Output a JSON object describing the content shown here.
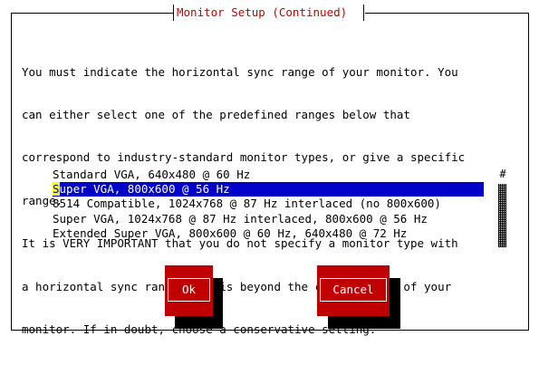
{
  "dialog": {
    "title": "Monitor Setup (Continued)",
    "body_lines": [
      "You must indicate the horizontal sync range of your monitor. You",
      "can either select one of the predefined ranges below that",
      "correspond to industry-standard monitor types, or give a specific",
      "range.",
      "It is VERY IMPORTANT that you do not specify a monitor type with",
      "a horizontal sync range that is beyond the capabilities of your",
      "monitor. If in doubt, choose a conservative setting."
    ]
  },
  "list": {
    "items": [
      {
        "label": "Standard VGA, 640x480 @ 60 Hz"
      },
      {
        "first_char": "S",
        "rest": "uper VGA, 800x600 @ 56 Hz",
        "selected": true
      },
      {
        "label": "8514 Compatible, 1024x768 @ 87 Hz interlaced (no 800x600)"
      },
      {
        "label": "Super VGA, 1024x768 @ 87 Hz interlaced, 800x600 @ 56 Hz"
      },
      {
        "label": "Extended Super VGA, 800x600 @ 60 Hz, 640x480 @ 72 Hz"
      }
    ],
    "scroll_marker": "#",
    "selection_color": "#0000c8"
  },
  "buttons": {
    "ok_label": "Ok",
    "cancel_label": "Cancel",
    "button_color": "#c00000"
  },
  "colors": {
    "title": "#c00000",
    "background": "#ffffff"
  }
}
